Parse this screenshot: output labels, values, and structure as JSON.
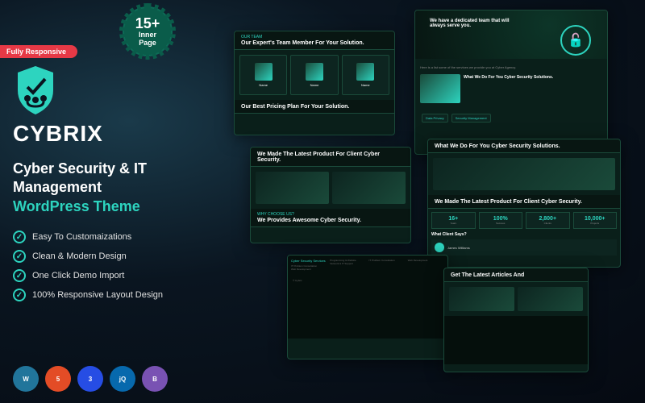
{
  "badges": {
    "responsive": "Fully Responsive",
    "starburst_num": "15+",
    "starburst_line1": "Inner",
    "starburst_line2": "Page"
  },
  "brand": "CYBRIX",
  "tagline_line1": "Cyber Security & IT",
  "tagline_line2": "Management",
  "tagline_line3": "WordPress Theme",
  "features": [
    "Easy To Customaizations",
    "Clean & Modern Design",
    "One Click Demo Import",
    "100% Responsive Layout Design"
  ],
  "tech": [
    "W",
    "5",
    "3",
    "jQ",
    "B"
  ],
  "mockups": {
    "m1": {
      "label": "Our Team",
      "title": "Our Expert's Team Member For Your Solution.",
      "plan": "Our Best Pricing Plan For Your Solution."
    },
    "m2": {
      "hero": "We have a dedicated team that will always serve you.",
      "sub": "Here is a list some of the services we provide you at Cyber Agency.",
      "svc_label": "What We Do For You Cyber Security Solutions.",
      "pills": [
        "Data Privacy",
        "Security Management"
      ]
    },
    "m3": {
      "label": "Why Choose us?",
      "title": "We Made The Latest Product For Client Cyber Security.",
      "sub": "We Provides Awesome Cyber Security."
    },
    "m4": {
      "title": "What We Do For You Cyber Security Solutions.",
      "title2": "We Made The Latest Product For Client Cyber Security.",
      "stats": [
        {
          "n": "16+",
          "l": "Years"
        },
        {
          "n": "100%",
          "l": "Success"
        },
        {
          "n": "2,800+",
          "l": "Clients"
        },
        {
          "n": "10,000+",
          "l": "Projects"
        }
      ],
      "testi_label": "What Client Says?",
      "testi_name": "James Williams"
    },
    "m5": {
      "svc": "Cyber Security Services",
      "items": [
        "IT Problem Consultation",
        "Web Development",
        "Programming & Website",
        "Network & IT Support"
      ]
    },
    "m6": {
      "title": "Get The Latest Articles And"
    }
  }
}
